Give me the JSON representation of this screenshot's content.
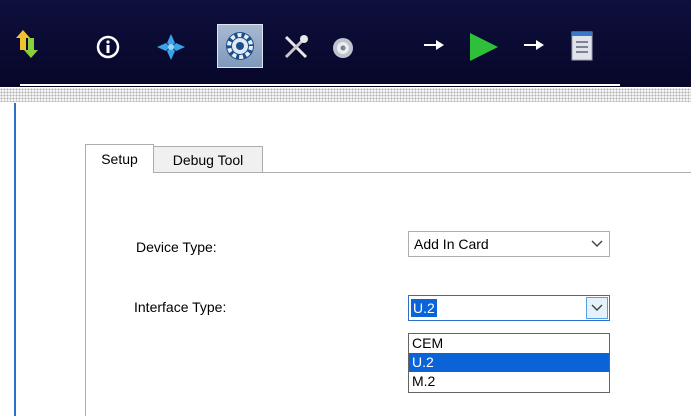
{
  "toolbar": {
    "icons": [
      "updown-arrows-icon",
      "info-icon",
      "compass-icon",
      "settings-gear-icon",
      "tools-icon",
      "disc-icon",
      "arrow-right-icon",
      "play-icon",
      "arrow-right-icon",
      "document-icon"
    ],
    "active_icon": "settings-gear-icon"
  },
  "tabs": [
    {
      "label": "Setup",
      "active": true
    },
    {
      "label": "Debug Tool",
      "active": false
    }
  ],
  "setup": {
    "device_type_label": "Device Type:",
    "device_type_value": "Add In Card",
    "interface_type_label": "Interface Type:",
    "interface_type_value": "U.2",
    "interface_options": [
      "CEM",
      "U.2",
      "M.2"
    ],
    "interface_selected_index": 1
  },
  "colors": {
    "toolbar_bg": "#0e0f3c",
    "selection": "#0a64d8",
    "panel_border": "#2a70c8"
  }
}
